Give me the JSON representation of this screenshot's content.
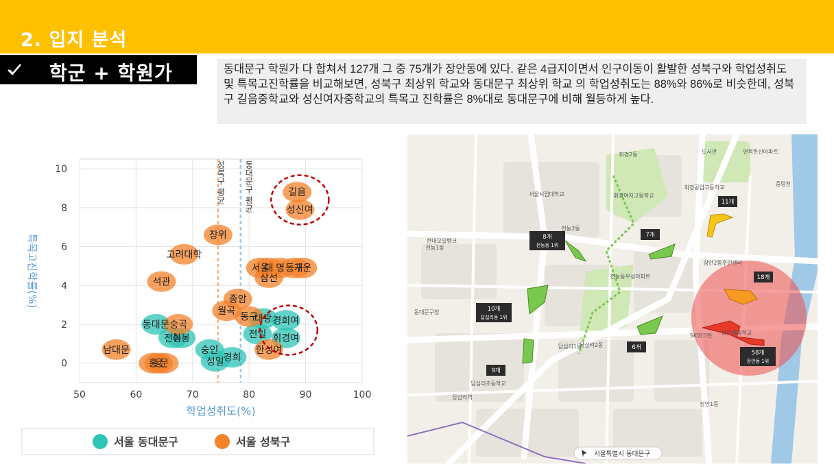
{
  "header": {
    "section_title": "2. 입지 분석",
    "accent_color": "#FFC000"
  },
  "subsection": {
    "check_icon": "checkmark-icon",
    "label": "학군 + 학원가"
  },
  "description": "동대문구 학원가 다 합쳐서 127개 그 중 75개가 장안동에 있다. 같은 4급지이면서 인구이동이 활발한 성북구와 학업성취도 및 특목고진학률을 비교해보면, 성북구 최상위 학교와 동대문구 최상위 학교 의 학업성취도는 88%와 86%로 비슷한데, 성북구 길음중학교와 성신여자중학교의 특목고 진학률은 8%대로 동대문구에 비해 월등하게 높다.",
  "chart_data": {
    "type": "scatter",
    "xlabel": "학업성취도(%)",
    "ylabel": "특목고진학률(%)",
    "xlim": [
      50,
      100
    ],
    "ylim": [
      -1,
      10.5
    ],
    "xticks": [
      50,
      60,
      70,
      80,
      90,
      100
    ],
    "yticks": [
      0,
      2,
      4,
      6,
      8,
      10
    ],
    "grid": true,
    "legend_placement": "bottom",
    "vlines": [
      {
        "x": 74.5,
        "label": "성북구 평균",
        "color": "#F4B183"
      },
      {
        "x": 78.5,
        "label": "동대문구 평균",
        "color": "#9DC3E6"
      }
    ],
    "highlights": [
      {
        "x": 89,
        "y": 8.4
      },
      {
        "x": 87,
        "y": 1.7
      }
    ],
    "series": [
      {
        "name": "서울 동대문구",
        "color": "#2EC4B6",
        "points": [
          {
            "x": 63.5,
            "y": 2,
            "label": "동대문"
          },
          {
            "x": 66.5,
            "y": 1.3,
            "label": "전농"
          },
          {
            "x": 68,
            "y": 1.3,
            "label": "휘봉"
          },
          {
            "x": 73,
            "y": 0.7,
            "label": "숭인"
          },
          {
            "x": 74,
            "y": 0.1,
            "label": "성일"
          },
          {
            "x": 77,
            "y": 0.3,
            "label": "경희"
          },
          {
            "x": 81.5,
            "y": 1.5,
            "label": "전일"
          },
          {
            "x": 82.5,
            "y": 2.3,
            "label": "대광"
          },
          {
            "x": 86.5,
            "y": 2.2,
            "label": "경희여"
          },
          {
            "x": 86.5,
            "y": 1.3,
            "label": "휘경여"
          }
        ]
      },
      {
        "name": "서울 성북구",
        "color": "#F4822A",
        "points": [
          {
            "x": 88.5,
            "y": 8.8,
            "label": "길음"
          },
          {
            "x": 89,
            "y": 7.9,
            "label": "성신여"
          },
          {
            "x": 74.5,
            "y": 6.6,
            "label": "장위"
          },
          {
            "x": 68.5,
            "y": 5.6,
            "label": "고려대학"
          },
          {
            "x": 82,
            "y": 4.9,
            "label": "서울"
          },
          {
            "x": 83.5,
            "y": 4.9,
            "label": "대"
          },
          {
            "x": 85.5,
            "y": 4.9,
            "label": "명"
          },
          {
            "x": 88,
            "y": 4.9,
            "label": "동구"
          },
          {
            "x": 89.5,
            "y": 4.9,
            "label": "개운"
          },
          {
            "x": 83.5,
            "y": 4.4,
            "label": "삼선"
          },
          {
            "x": 64.5,
            "y": 4.2,
            "label": "석관"
          },
          {
            "x": 78,
            "y": 3.3,
            "label": "종암"
          },
          {
            "x": 76,
            "y": 2.7,
            "label": "월곡"
          },
          {
            "x": 80,
            "y": 2.4,
            "label": "동구"
          },
          {
            "x": 67.5,
            "y": 2,
            "label": "숭곡"
          },
          {
            "x": 56.5,
            "y": 0.7,
            "label": "남대문"
          },
          {
            "x": 63,
            "y": 0,
            "label": "홍"
          },
          {
            "x": 64,
            "y": 0,
            "label": "용"
          },
          {
            "x": 65,
            "y": 0,
            "label": "문"
          },
          {
            "x": 83.5,
            "y": 0.7,
            "label": "한성여"
          }
        ]
      }
    ]
  },
  "map": {
    "bottom_label": "서울특별시 동대문구",
    "counts": [
      {
        "count": "8개",
        "sub": "전농동 1위"
      },
      {
        "count": "7개",
        "sub": ""
      },
      {
        "count": "11개",
        "sub": ""
      },
      {
        "count": "18개",
        "sub": ""
      },
      {
        "count": "10개",
        "sub": "답십리동 1위"
      },
      {
        "count": "6개",
        "sub": ""
      },
      {
        "count": "9개",
        "sub": ""
      },
      {
        "count": "58개",
        "sub": "장안동 1위"
      }
    ],
    "place_labels": [
      "휘경2동",
      "휘경여자고등학교",
      "서울시립대학교",
      "휘경공업고등학교",
      "전농2동",
      "현대오일뱅크",
      "전농1동",
      "전농동우성아파트",
      "장안2동주민센터",
      "답십리1동",
      "답십리2동",
      "동대문구청",
      "장안1동",
      "장안평중학교",
      "답십리역",
      "도서관",
      "면목한신아파트",
      "중랑천",
      "SK엔크린",
      "답십리초등학교",
      "서울특별시 동대문구"
    ],
    "colors": {
      "park": "#79C84E",
      "academy_zone": "#E8392B",
      "highlight_circle": "#EE4F4F",
      "road": "#ffffff",
      "water": "#9FC9E6"
    }
  }
}
